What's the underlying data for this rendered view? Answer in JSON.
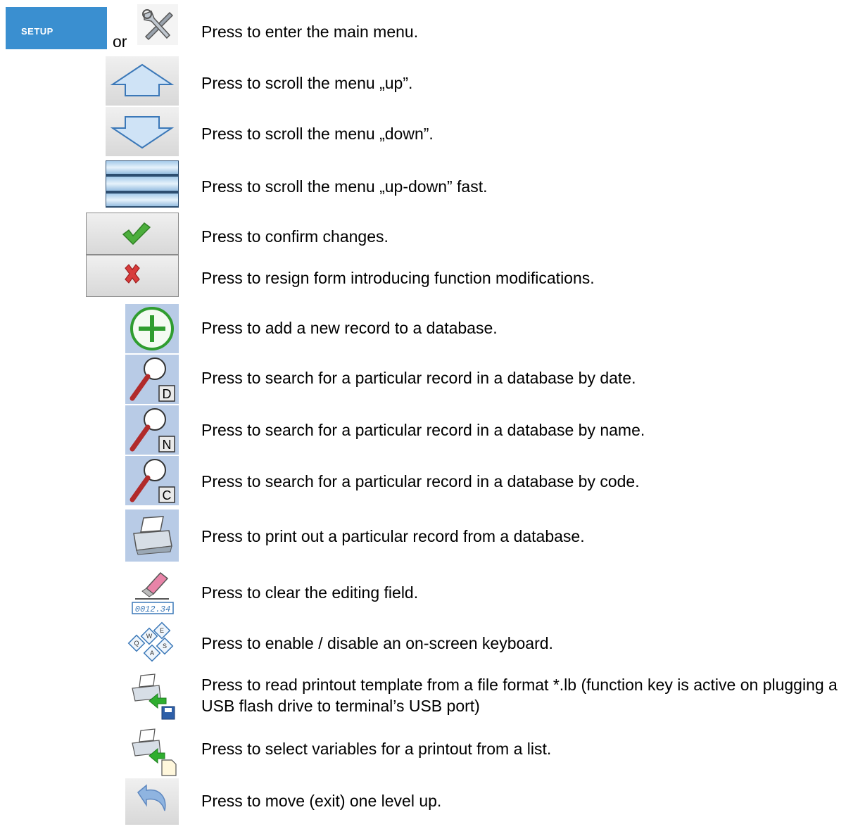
{
  "setup": {
    "button_label": "SETUP",
    "or_text": "or"
  },
  "rows": [
    {
      "text": "Press to enter the main menu.",
      "icon": "tools-icon"
    },
    {
      "text": "Press to scroll the menu „up”.",
      "icon": "arrow-up-icon"
    },
    {
      "text": "Press to scroll the menu „down”.",
      "icon": "arrow-down-icon"
    },
    {
      "text": "Press to scroll the menu „up-down” fast.",
      "icon": "scroll-bar-icon"
    },
    {
      "text": "Press to confirm changes.",
      "icon": "checkmark-icon"
    },
    {
      "text": "Press to resign form introducing function modifications.",
      "icon": "cross-icon"
    },
    {
      "text": "Press to add a new record to a database.",
      "icon": "add-icon"
    },
    {
      "text": "Press to search for a particular record in a database by date.",
      "icon": "search-date-icon",
      "letter": "D"
    },
    {
      "text": "Press to search for a particular record in a database by name.",
      "icon": "search-name-icon",
      "letter": "N"
    },
    {
      "text": "Press to search for a particular record in a database by code.",
      "icon": "search-code-icon",
      "letter": "C"
    },
    {
      "text": "Press to print out a particular record from a database.",
      "icon": "printer-icon"
    },
    {
      "text": "Press to clear the editing field.",
      "icon": "eraser-icon",
      "digits": "0012.34"
    },
    {
      "text": "Press to enable / disable an on-screen keyboard.",
      "icon": "keyboard-icon",
      "keys": [
        "Q",
        "W",
        "E",
        "A",
        "S"
      ]
    },
    {
      "text": "Press to read printout template from a file format *.lb (function key is active on plugging a USB flash drive to terminal’s USB port)",
      "icon": "printer-usb-icon"
    },
    {
      "text": "Press to select variables for a printout from a list.",
      "icon": "printer-list-icon"
    },
    {
      "text": "Press to move (exit) one level up.",
      "icon": "back-arrow-icon"
    }
  ]
}
